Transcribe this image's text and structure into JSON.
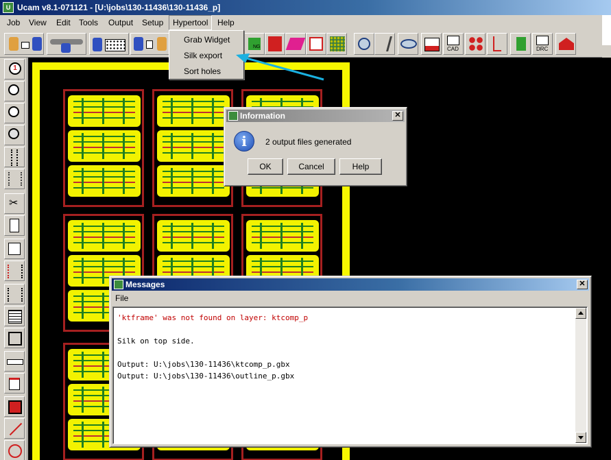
{
  "window": {
    "title": "Ucam v8.1-071121 - [U:\\jobs\\130-11436\\130-11436_p]",
    "app_icon": "ucam-app-icon"
  },
  "menubar": {
    "items": [
      {
        "label": "Job"
      },
      {
        "label": "View"
      },
      {
        "label": "Edit"
      },
      {
        "label": "Tools"
      },
      {
        "label": "Output"
      },
      {
        "label": "Setup"
      },
      {
        "label": "Hypertool"
      },
      {
        "label": "Help"
      }
    ]
  },
  "hypertool_menu": {
    "items": [
      {
        "label": "Grab Widget"
      },
      {
        "label": "Silk export"
      },
      {
        "label": "Sort holes"
      }
    ]
  },
  "info_dialog": {
    "title": "Information",
    "message": "2 output files generated",
    "icon": "i",
    "buttons": {
      "ok": "OK",
      "cancel": "Cancel",
      "help": "Help"
    }
  },
  "messages_window": {
    "title": "Messages",
    "menu_file": "File",
    "lines": [
      "'ktframe' was not found on layer: ktcomp_p",
      "",
      "Silk on top side.",
      "",
      "Output: U:\\jobs\\130-11436\\ktcomp_p.gbx",
      "Output: U:\\jobs\\130-11436\\outline_p.gbx"
    ]
  },
  "toolbar_labels": {
    "cad": "CAD",
    "drc": "DRC",
    "ng": "NG"
  },
  "left_tools": {
    "step_one": "1"
  },
  "colors": {
    "title_active": "#0a246a",
    "board_yellow": "#f7f700",
    "error_text": "#c00000",
    "arrow": "#1ab0e0"
  }
}
